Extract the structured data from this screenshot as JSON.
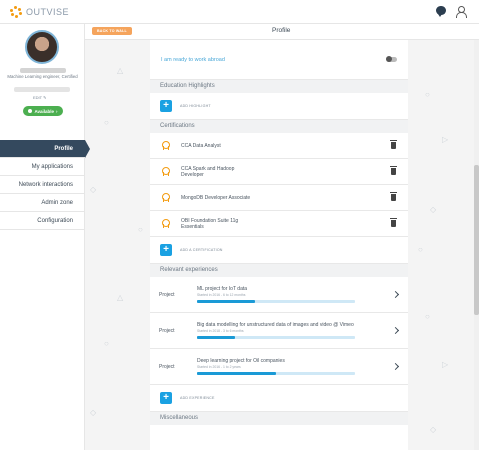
{
  "brand": {
    "name": "OUTVISE"
  },
  "topbar": {
    "icons": [
      "chat-icon",
      "user-icon"
    ]
  },
  "profile": {
    "job_title": "Machine Learning engineer, Certified",
    "edit_label": "EDIT",
    "availability": "Available"
  },
  "nav": {
    "items": [
      {
        "label": "Profile",
        "active": true
      },
      {
        "label": "My applications"
      },
      {
        "label": "Network interactions"
      },
      {
        "label": "Admin zone"
      },
      {
        "label": "Configuration"
      }
    ]
  },
  "header": {
    "back_label": "BACK TO WALL",
    "title": "Profile"
  },
  "abroad": {
    "label": "I am ready to work abroad",
    "enabled": false
  },
  "education": {
    "heading": "Education Highlights",
    "add_label": "ADD HIGHLIGHT"
  },
  "certifications": {
    "heading": "Certifications",
    "items": [
      {
        "name": "CCA Data Analyst"
      },
      {
        "name": "CCA Spark and Hadoop Developer"
      },
      {
        "name": "MongoDB Developer Associate"
      },
      {
        "name": "OBI Foundation Suite 11g Essentials"
      }
    ],
    "add_label": "ADD A CERTIFICATION"
  },
  "experiences": {
    "heading": "Relevant experiences",
    "items": [
      {
        "type": "Project",
        "title": "ML project for IoT data",
        "sub": "Started in 2016 - 6 to 12 months",
        "progress": 0.37
      },
      {
        "type": "Project",
        "title": "Big data modelling for unstructured data of images and video @ Vimeo",
        "sub": "Started in 2018 - 3 to 6 months",
        "progress": 0.24
      },
      {
        "type": "Project",
        "title": "Deep learning project for Oil companies",
        "sub": "Started in 2016 - 1 to 2 years",
        "progress": 0.5
      }
    ],
    "add_label": "ADD EXPERIENCE"
  },
  "misc": {
    "heading": "Miscellaneous"
  },
  "colors": {
    "accent": "#1aa1e2",
    "nav_active": "#34495e",
    "available": "#4caf50",
    "back_button": "#f5a45c",
    "medal": "#f39c12"
  }
}
